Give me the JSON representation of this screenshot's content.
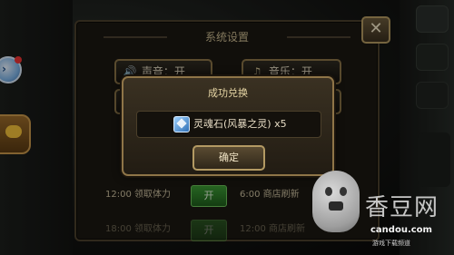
{
  "settings": {
    "title": "系统设置",
    "sound_label": "声音：开",
    "music_label": "音乐：开",
    "sound_icon": "speaker-icon",
    "music_icon": "music-note-icon",
    "schedule": [
      {
        "left": "12:00 领取体力",
        "toggle": "开",
        "right": "6:00 商店刷新"
      },
      {
        "left": "18:00 领取体力",
        "toggle": "开",
        "right": "12:00 商店刷新"
      }
    ]
  },
  "dialog": {
    "title": "成功兑换",
    "reward_text": "灵魂石(风暴之灵) x5",
    "confirm_label": "确定"
  },
  "watermark": {
    "logo": "香豆网",
    "url": "candou.com",
    "sub": "游戏下载频道"
  },
  "colors": {
    "panel_border": "#8f7548",
    "text_gold": "#e8d7a6",
    "toggle_green": "#3c9a34"
  }
}
